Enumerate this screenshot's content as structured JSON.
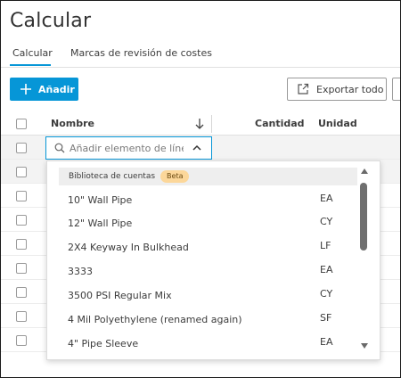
{
  "page": {
    "title": "Calcular"
  },
  "tabs": [
    {
      "label": "Calcular",
      "active": true
    },
    {
      "label": "Marcas de revisión de costes",
      "active": false
    }
  ],
  "toolbar": {
    "add_label": "Añadir",
    "export_label": "Exportar todo"
  },
  "table": {
    "columns": {
      "name": "Nombre",
      "quantity": "Cantidad",
      "unit": "Unidad"
    },
    "row_count": 9
  },
  "search": {
    "placeholder": "Añadir elemento de línea"
  },
  "dropdown": {
    "header": "Biblioteca de cuentas",
    "badge": "Beta",
    "items": [
      {
        "name": "10\" Wall Pipe",
        "unit": "EA"
      },
      {
        "name": "12\" Wall Pipe",
        "unit": "CY"
      },
      {
        "name": "2X4 Keyway In Bulkhead",
        "unit": "LF"
      },
      {
        "name": "3333",
        "unit": "EA"
      },
      {
        "name": "3500 PSI Regular Mix",
        "unit": "CY"
      },
      {
        "name": "4 Mil Polyethylene (renamed again)",
        "unit": "SF"
      },
      {
        "name": "4\" Pipe Sleeve",
        "unit": "EA"
      }
    ]
  },
  "colors": {
    "accent": "#0696d7",
    "badge_bg": "#fcd79a",
    "row_shade": "#f3f3f3"
  },
  "icons": {
    "add": "plus-icon",
    "export": "export-icon",
    "sort": "arrow-down-icon",
    "search": "search-icon",
    "collapse": "chevron-up-icon"
  }
}
